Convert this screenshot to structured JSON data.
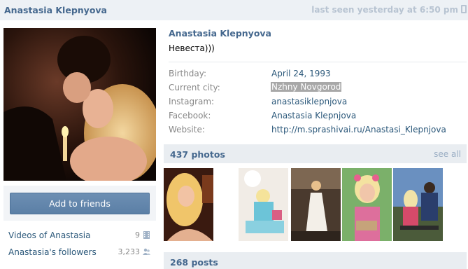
{
  "header": {
    "name": "Anastasia Klepnyova",
    "last_seen": "last seen yesterday at 6:50 pm"
  },
  "profile": {
    "full_name": "Anastasia Klepnyova",
    "status": "Невеста)))",
    "fields": [
      {
        "label": "Birthday:",
        "value": "April 24, 1993"
      },
      {
        "label": "Current city:",
        "value": "Nzhny Novgorod"
      },
      {
        "label": "Instagram:",
        "value": "anastasiklepnjova"
      },
      {
        "label": "Facebook:",
        "value": "Anastasia Klepnjova"
      },
      {
        "label": "Website:",
        "value": "http://m.sprashivai.ru/Anastasi_Klepnjova"
      }
    ]
  },
  "actions": {
    "add_friend_label": "Add to friends"
  },
  "side_links": [
    {
      "label": "Videos of Anastasia",
      "count": "9",
      "icon": "film-icon"
    },
    {
      "label": "Anastasia's followers",
      "count": "3,233",
      "icon": "people-icon"
    }
  ],
  "photos": {
    "title": "437 photos",
    "see_all": "see all"
  },
  "posts": {
    "title": "268 posts"
  },
  "colors": {
    "link": "#2b587a",
    "header_name": "#45688e",
    "button": "#5e82a8",
    "bar_bg": "#e9edf1"
  }
}
